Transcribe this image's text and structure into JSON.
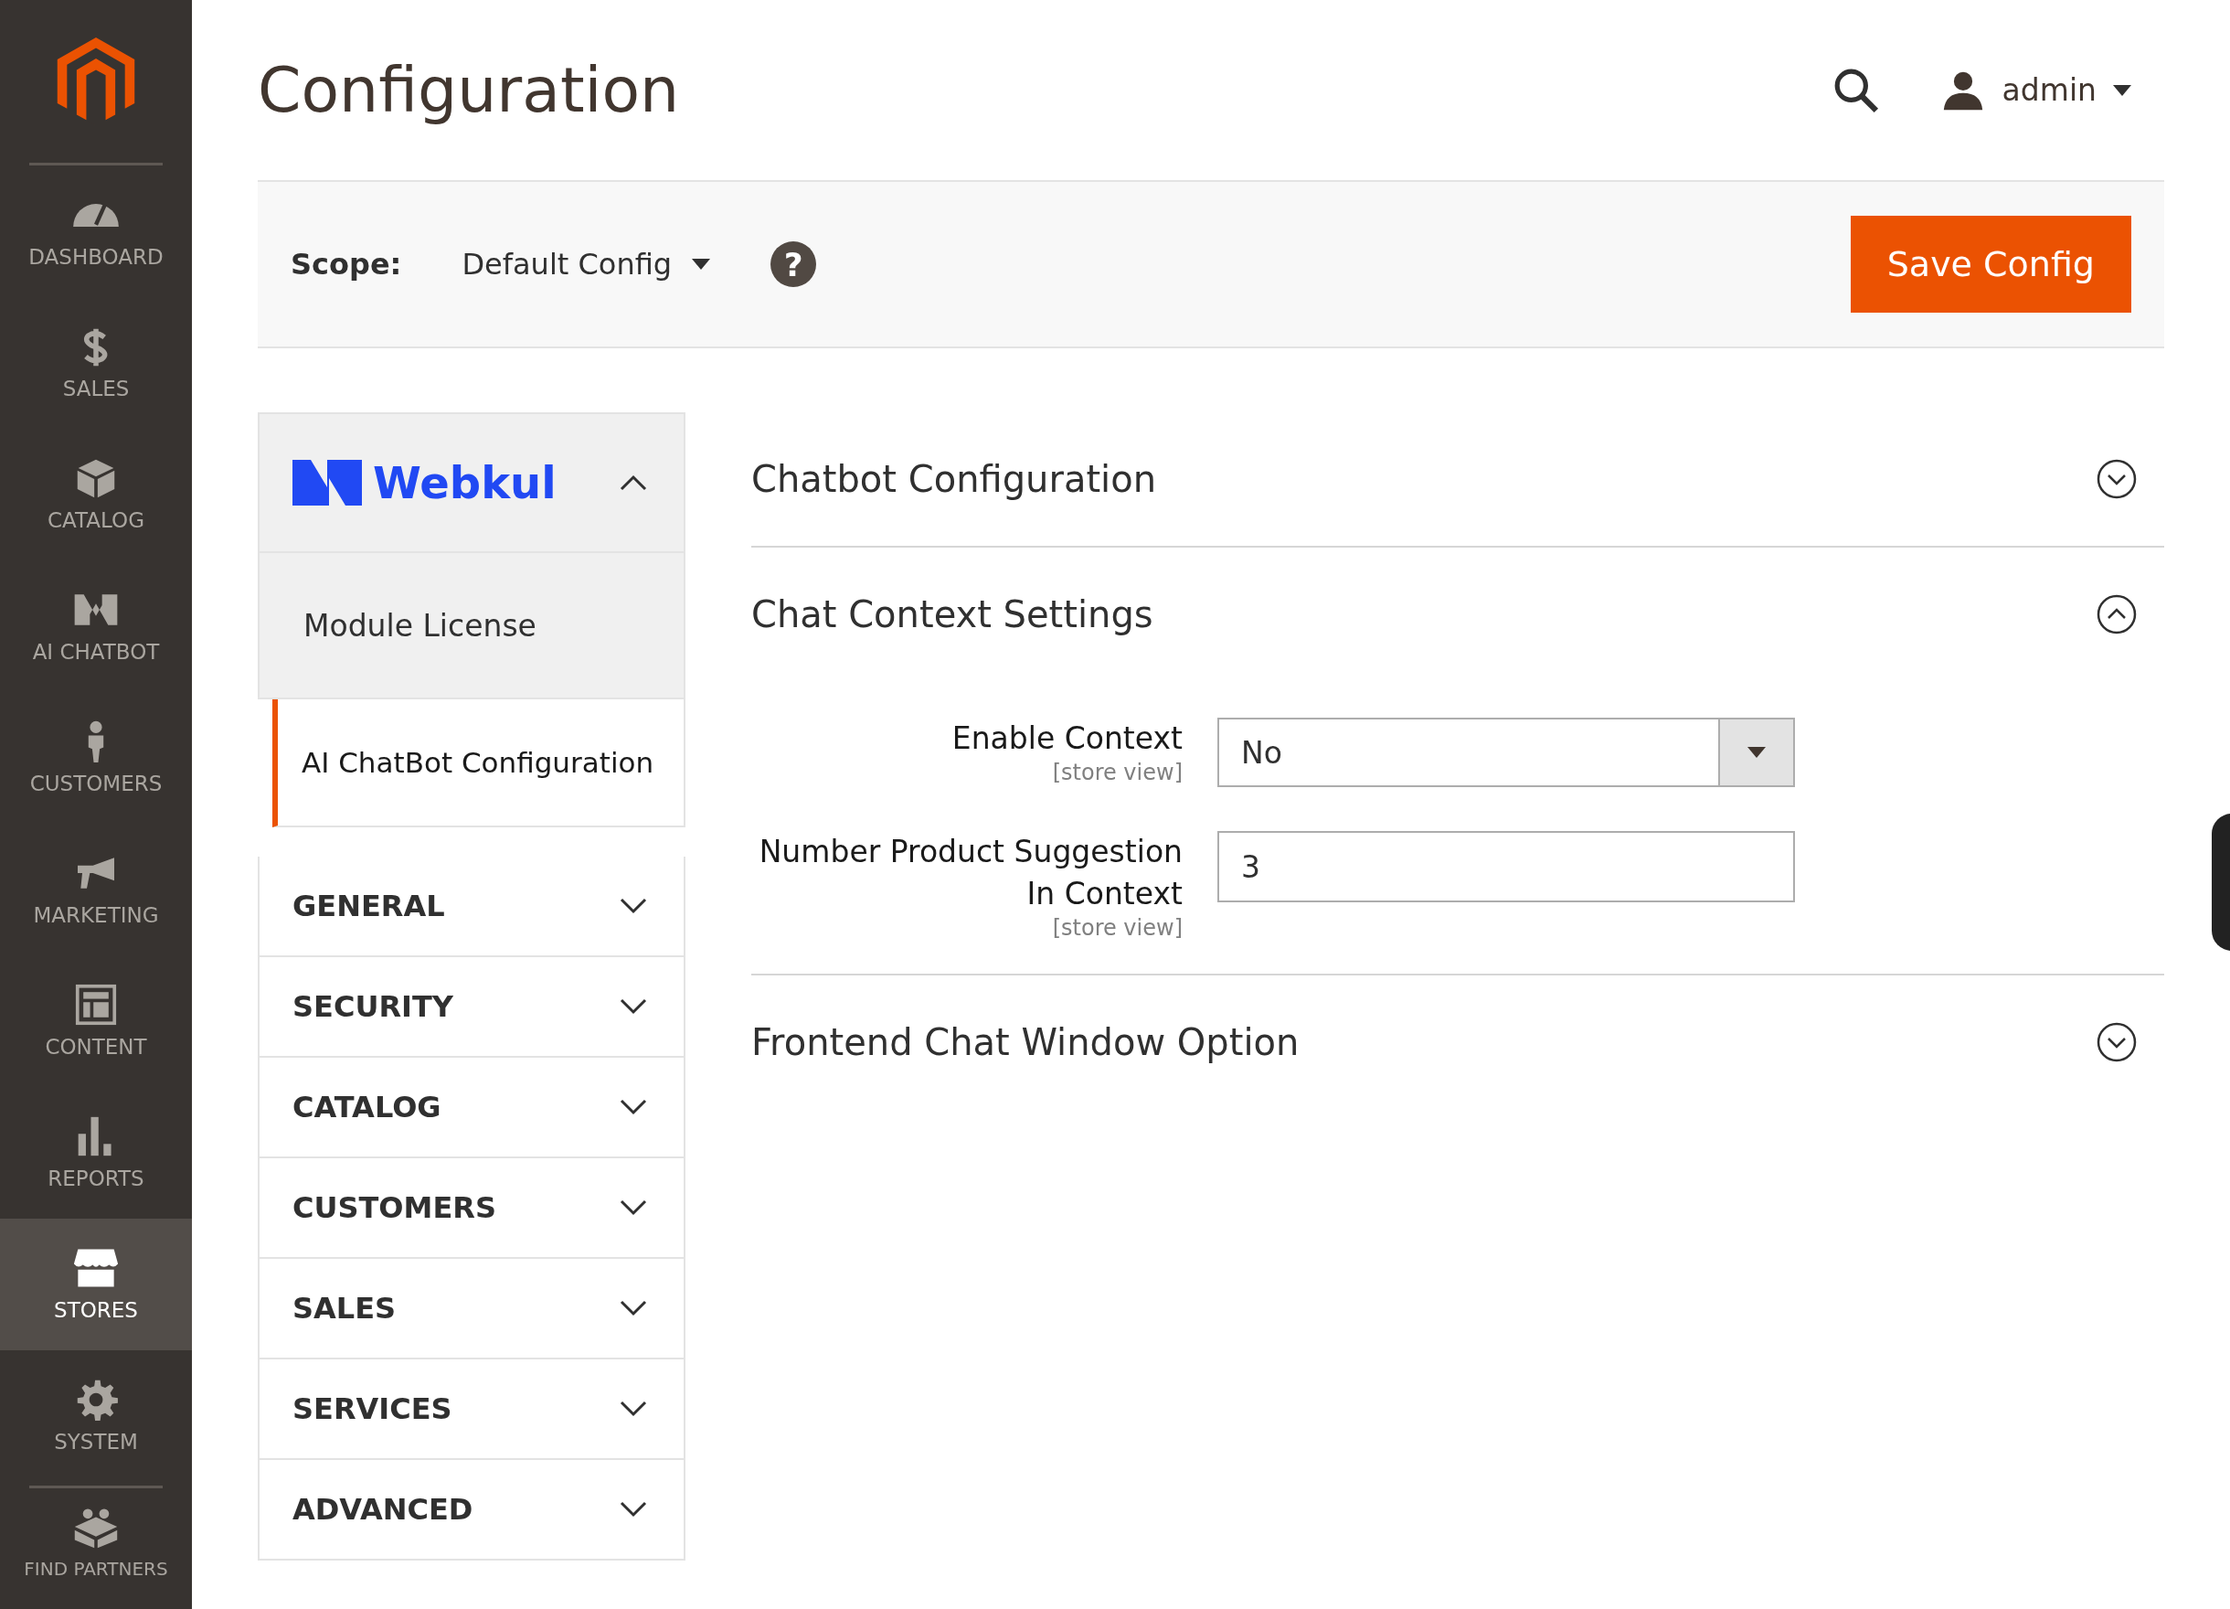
{
  "sidebar": {
    "items": [
      {
        "label": "DASHBOARD",
        "selected": false
      },
      {
        "label": "SALES",
        "selected": false
      },
      {
        "label": "CATALOG",
        "selected": false
      },
      {
        "label": "AI CHATBOT",
        "selected": false
      },
      {
        "label": "CUSTOMERS",
        "selected": false
      },
      {
        "label": "MARKETING",
        "selected": false
      },
      {
        "label": "CONTENT",
        "selected": false
      },
      {
        "label": "REPORTS",
        "selected": false
      },
      {
        "label": "STORES",
        "selected": true
      },
      {
        "label": "SYSTEM",
        "selected": false
      }
    ],
    "extra": {
      "label": "FIND PARTNERS"
    }
  },
  "page_title": "Configuration",
  "user": {
    "name": "admin"
  },
  "scope": {
    "label": "Scope:",
    "value": "Default Config",
    "help": "?"
  },
  "save_button": "Save Config",
  "config_nav": {
    "brand": {
      "name": "Webkul",
      "expanded": true,
      "items": [
        {
          "label": "Module License",
          "selected": false
        },
        {
          "label": "AI ChatBot Configuration",
          "selected": true
        }
      ]
    },
    "groups": [
      {
        "label": "GENERAL",
        "expanded": false
      },
      {
        "label": "SECURITY",
        "expanded": false
      },
      {
        "label": "CATALOG",
        "expanded": false
      },
      {
        "label": "CUSTOMERS",
        "expanded": false
      },
      {
        "label": "SALES",
        "expanded": false
      },
      {
        "label": "SERVICES",
        "expanded": false
      },
      {
        "label": "ADVANCED",
        "expanded": false
      }
    ]
  },
  "sections": [
    {
      "title": "Chatbot Configuration",
      "expanded": false
    },
    {
      "title": "Chat Context Settings",
      "expanded": true,
      "fields": [
        {
          "kind": "select",
          "label": "Enable Context",
          "scope": "[store view]",
          "value": "No"
        },
        {
          "kind": "text",
          "label": "Number Product Suggestion In Context",
          "scope": "[store view]",
          "value": "3"
        }
      ]
    },
    {
      "title": "Frontend Chat Window Option",
      "expanded": false
    }
  ]
}
